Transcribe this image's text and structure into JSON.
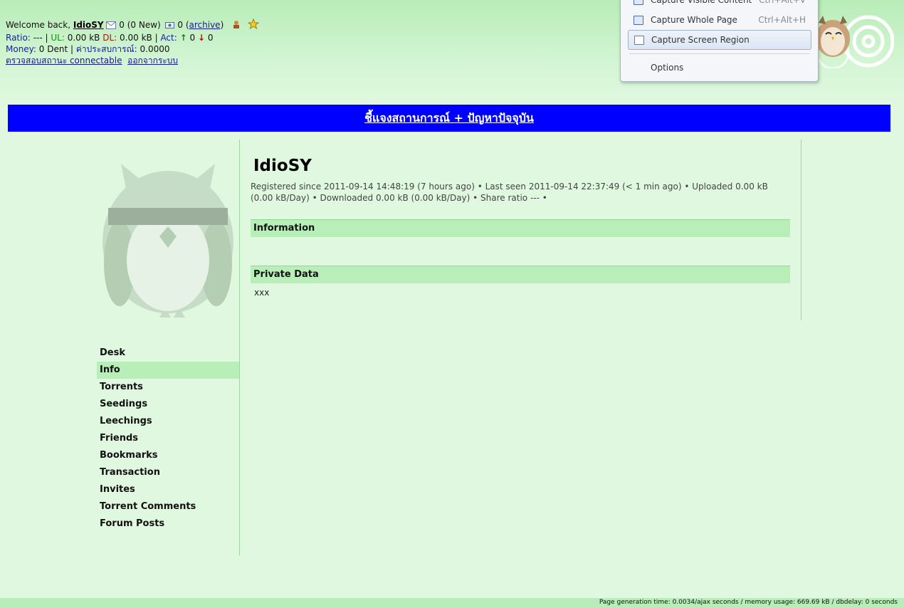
{
  "header": {
    "welcome_prefix": "Welcome back,",
    "username": "IdioSY",
    "messages": "0 (0 New)",
    "inbox_count": "0",
    "archive_link": "archive",
    "ratio_label": "Ratio:",
    "ratio_value": "---",
    "ul_label": "UL:",
    "ul_value": "0.00 kB",
    "dl_label": "DL:",
    "dl_value": "0.00 kB",
    "act_label": "Act:",
    "act_up": "0",
    "act_down": "0",
    "money_label": "Money:",
    "money_value": "0 Dent",
    "exp_label": "ค่าประสบการณ์:",
    "exp_value": "0.0000",
    "connectable_link": "ตรวจสอบสถานะ connectable",
    "logout_link": "ออกจากระบบ"
  },
  "banner": {
    "text": "ชี้แจงสถานการณ์ + ปัญหาปัจจุบัน"
  },
  "popup_menu": {
    "items": [
      {
        "label": "Capture Visible Content",
        "shortcut": "Ctrl+Alt+V"
      },
      {
        "label": "Capture Whole Page",
        "shortcut": "Ctrl+Alt+H"
      },
      {
        "label": "Capture Screen Region",
        "shortcut": ""
      },
      {
        "label": "Options",
        "shortcut": ""
      }
    ]
  },
  "sidebar": {
    "items": [
      {
        "label": "Desk"
      },
      {
        "label": "Info"
      },
      {
        "label": "Torrents"
      },
      {
        "label": "Seedings"
      },
      {
        "label": "Leechings"
      },
      {
        "label": "Friends"
      },
      {
        "label": "Bookmarks"
      },
      {
        "label": "Transaction"
      },
      {
        "label": "Invites"
      },
      {
        "label": "Torrent Comments"
      },
      {
        "label": "Forum Posts"
      }
    ],
    "active_index": 1
  },
  "profile": {
    "username": "IdioSY",
    "meta": "Registered since 2011-09-14 14:48:19 (7 hours ago) • Last seen 2011-09-14 22:37:49 (< 1 min ago) • Uploaded 0.00 kB (0.00 kB/Day) • Downloaded 0.00 kB (0.00 kB/Day) • Share ratio --- •",
    "information_header": "Information",
    "private_header": "Private Data",
    "private_value": "xxx"
  },
  "footer": {
    "text": "Page generation time: 0.0034/ajax seconds / memory usage: 669.69 kB / dbdelay: 0 seconds"
  },
  "colors": {
    "background": "#dff8df",
    "accent_green": "#b8efb8",
    "banner_blue": "#0000ff"
  }
}
